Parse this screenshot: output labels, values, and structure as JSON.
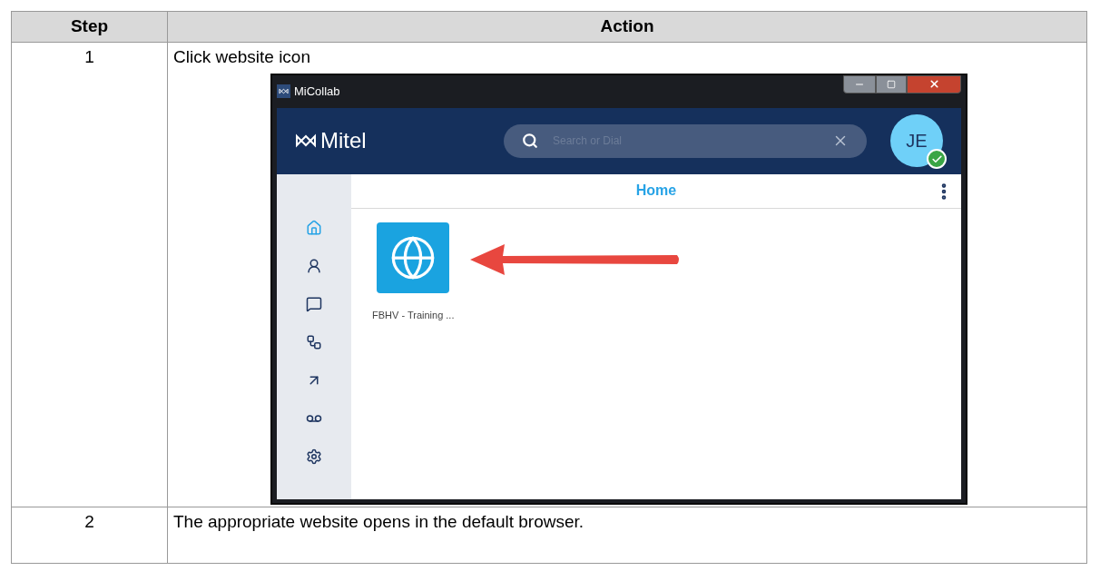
{
  "table": {
    "columns": [
      "Step",
      "Action"
    ],
    "rows": [
      {
        "step": "1",
        "action": "Click website icon",
        "screenshot": {
          "window_title": "MiCollab",
          "logo": "Mitel",
          "search": {
            "placeholder": "Search or Dial"
          },
          "avatar": {
            "initials": "JE",
            "online": true
          },
          "page_title": "Home",
          "nav": [
            {
              "kind": "home",
              "selected": true
            },
            {
              "kind": "contacts",
              "selected": false
            },
            {
              "kind": "chat",
              "selected": false
            },
            {
              "kind": "collaboration",
              "selected": false
            },
            {
              "kind": "calls",
              "selected": false
            },
            {
              "kind": "voicemail",
              "selected": false
            },
            {
              "kind": "settings",
              "selected": false
            }
          ],
          "tiles": [
            {
              "label": "FBHV - Training ..."
            }
          ]
        }
      },
      {
        "step": "2",
        "action": "The appropriate website opens in the default browser."
      }
    ]
  }
}
